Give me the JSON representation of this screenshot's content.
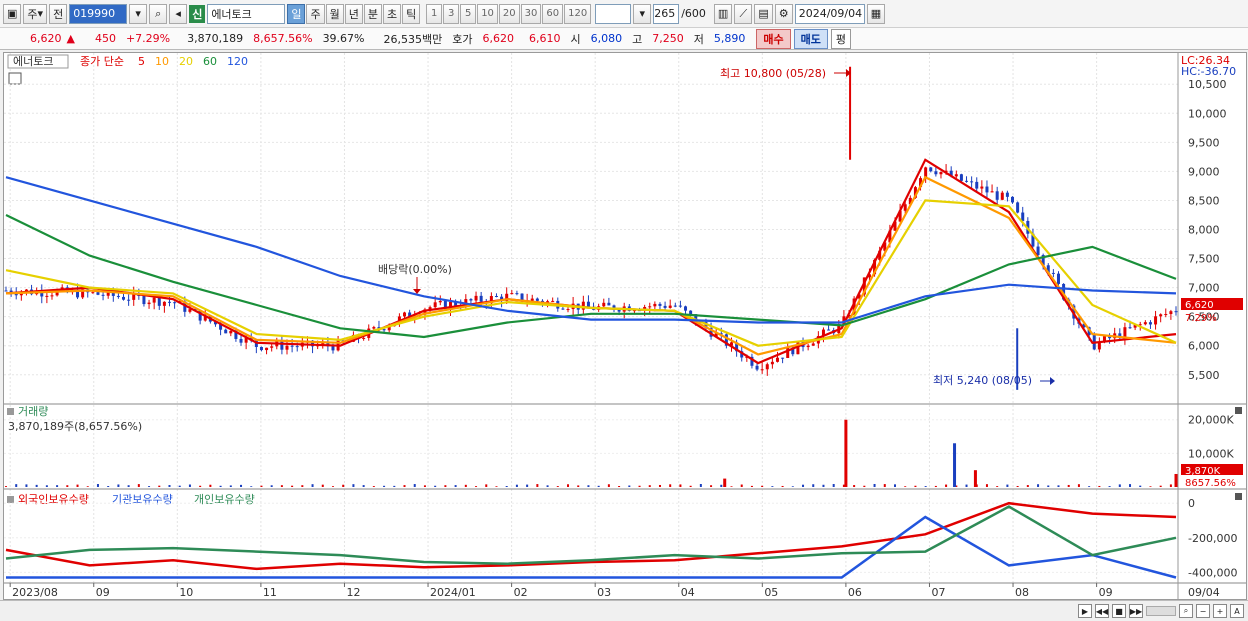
{
  "toolbar": {
    "period_btn": "주",
    "prev_btn": "전",
    "code": "019990",
    "sin_badge": "신",
    "name": "에너토크",
    "periods": [
      "일",
      "주",
      "월",
      "년",
      "분",
      "초",
      "틱"
    ],
    "numbers": [
      "1",
      "3",
      "5",
      "10",
      "20",
      "30",
      "60",
      "120"
    ],
    "count": "265",
    "count_total": "/600",
    "date": "2024/09/04"
  },
  "quote": {
    "price": "6,620",
    "arrow": "▲",
    "change": "450",
    "change_pct": "+7.29%",
    "volume": "3,870,189",
    "vol_ratio": "8,657.56%",
    "turnover": "39.67%",
    "amount": "26,535백만",
    "hoga_label": "호가",
    "ask": "6,620",
    "bid": "6,610",
    "open_label": "시",
    "open": "6,080",
    "high_label": "고",
    "high": "7,250",
    "low_label": "저",
    "low": "5,890",
    "buy_btn": "매수",
    "sell_btn": "매도",
    "pyeong_btn": "평"
  },
  "price_panel": {
    "stock_label": "에너토크",
    "ma_label": "종가 단순",
    "ma_periods": [
      "5",
      "10",
      "20",
      "60",
      "120"
    ],
    "ma_colors": [
      "#e00000",
      "#ff9900",
      "#e6d000",
      "#1a8f3a",
      "#2255dd"
    ],
    "lc": "LC:26.34",
    "hc": "HC:-36.70",
    "high_note": "최고 10,800 (05/28)",
    "low_note": "최저 5,240 (08/05)",
    "dividend_note": "배당락(0.00%)",
    "y_ticks": [
      "10,500",
      "10,000",
      "9,500",
      "9,000",
      "8,500",
      "8,000",
      "7,500",
      "7,000",
      "6,500",
      "6,000",
      "5,500"
    ],
    "last_price_tag": "6,620",
    "last_pct_tag": "7.29%"
  },
  "volume_panel": {
    "label": "거래량",
    "value": "3,870,189주(8,657.56%)",
    "y_ticks": [
      "20,000K",
      "10,000K"
    ],
    "tag_value": "3,870K",
    "tag_pct": "8657.56%"
  },
  "holding_panel": {
    "series_labels": [
      "외국인보유수량",
      "기관보유수량",
      "개인보유수량"
    ],
    "colors": [
      "#e00000",
      "#2255dd",
      "#2e8b57"
    ],
    "y_ticks": [
      "0",
      "-200,000",
      "-400,000"
    ]
  },
  "x_axis": {
    "labels": [
      "2023/08",
      "09",
      "10",
      "11",
      "12",
      "2024/01",
      "02",
      "03",
      "04",
      "05",
      "06",
      "07",
      "08",
      "09"
    ],
    "right_label": "09/04"
  },
  "chart_data": [
    {
      "type": "candlestick",
      "title": "에너토크",
      "ylim": [
        5100,
        10900
      ],
      "x": [
        "2023/08",
        "09",
        "10",
        "11",
        "12",
        "2024/01",
        "02",
        "03",
        "04",
        "05",
        "06",
        "07",
        "08",
        "09"
      ],
      "close": [
        6950,
        6900,
        6750,
        6000,
        6000,
        6650,
        6850,
        6650,
        6700,
        5650,
        6350,
        9100,
        8500,
        6000,
        6620
      ],
      "annotations": [
        {
          "label": "최고 10,800 (05/28)",
          "value": 10800
        },
        {
          "label": "최저 5,240 (08/05)",
          "value": 5240
        },
        {
          "label": "배당락(0.00%)"
        }
      ],
      "series": [
        {
          "name": "5",
          "values": [
            6900,
            7000,
            6800,
            6050,
            6000,
            6600,
            6800,
            6650,
            6600,
            5700,
            6300,
            9200,
            8300,
            6050,
            6200
          ]
        },
        {
          "name": "10",
          "values": [
            6900,
            6950,
            6850,
            6100,
            6050,
            6550,
            6800,
            6650,
            6600,
            5850,
            6200,
            8900,
            8200,
            6200,
            6050
          ]
        },
        {
          "name": "20",
          "values": [
            7300,
            7000,
            6900,
            6200,
            6100,
            6500,
            6750,
            6650,
            6600,
            6000,
            6150,
            8500,
            8400,
            6700,
            6050
          ]
        },
        {
          "name": "60",
          "values": [
            8250,
            7550,
            7100,
            6700,
            6300,
            6150,
            6400,
            6550,
            6550,
            6450,
            6350,
            6800,
            7400,
            7700,
            7150
          ]
        },
        {
          "name": "120",
          "values": [
            8900,
            8500,
            8100,
            7700,
            7200,
            6850,
            6600,
            6450,
            6450,
            6400,
            6400,
            6850,
            7050,
            6950,
            6900
          ]
        }
      ]
    },
    {
      "type": "bar",
      "title": "거래량",
      "unit": "K",
      "ylim": [
        0,
        22000
      ],
      "spikes": [
        {
          "x": "04",
          "value": 2500
        },
        {
          "x": "05",
          "value": 20000
        },
        {
          "x": "07",
          "value": 13000
        },
        {
          "x": "07",
          "value": 5000
        },
        {
          "x": "09",
          "value": 3870
        }
      ]
    },
    {
      "type": "line",
      "ylim": [
        -450000,
        30000
      ],
      "series": [
        {
          "name": "외국인보유수량",
          "values": [
            -270000,
            -360000,
            -330000,
            -380000,
            -350000,
            -370000,
            -360000,
            -340000,
            -330000,
            -290000,
            -250000,
            -180000,
            0,
            -60000,
            -80000
          ]
        },
        {
          "name": "기관보유수량",
          "values": [
            -430000,
            -430000,
            -430000,
            -430000,
            -430000,
            -430000,
            -430000,
            -430000,
            -430000,
            -430000,
            -430000,
            -80000,
            -360000,
            -300000,
            -430000
          ]
        },
        {
          "name": "개인보유수량",
          "values": [
            -320000,
            -270000,
            -260000,
            -280000,
            -300000,
            -340000,
            -350000,
            -330000,
            -300000,
            -320000,
            -290000,
            -280000,
            -20000,
            -300000,
            -200000
          ]
        }
      ]
    }
  ]
}
